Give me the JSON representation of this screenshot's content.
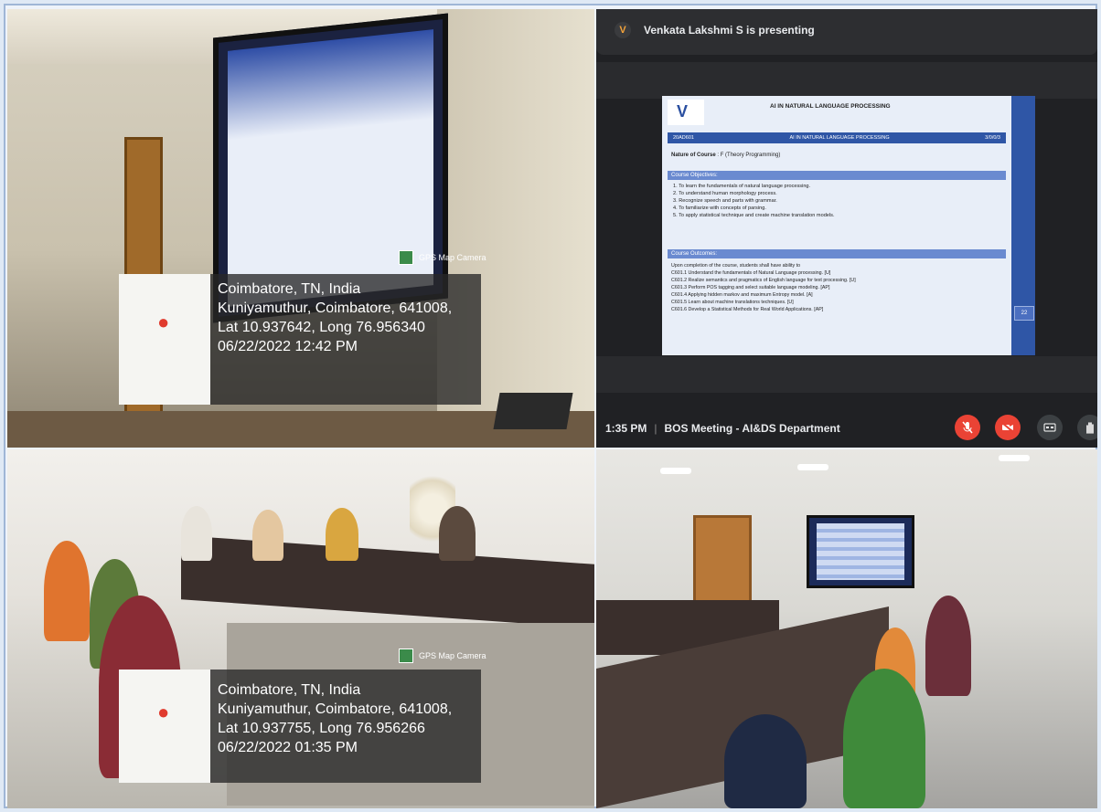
{
  "gps_top": {
    "tag": "GPS Map Camera",
    "line1": "Coimbatore, TN, India",
    "line2": "Kuniyamuthur, Coimbatore, 641008,",
    "line3": "Lat 10.937642, Long 76.956340",
    "line4": "06/22/2022 12:42 PM"
  },
  "gps_bottom": {
    "tag": "GPS Map Camera",
    "line1": "Coimbatore, TN, India",
    "line2": "Kuniyamuthur, Coimbatore, 641008,",
    "line3": "Lat 10.937755, Long 76.956266",
    "line4": "06/22/2022 01:35 PM"
  },
  "meeting": {
    "presenter_initial": "V",
    "presenter_text": "Venkata Lakshmi S is presenting",
    "time": "1:35 PM",
    "meeting_name": "BOS Meeting - AI&DS Department",
    "controls": [
      "mic-off-icon",
      "camera-off-icon",
      "captions-icon",
      "raise-hand-icon"
    ]
  },
  "slide": {
    "title": "AI IN NATURAL LANGUAGE PROCESSING",
    "code": "20AD601",
    "course": "AI IN NATURAL LANGUAGE PROCESSING",
    "credits": "3/0/0/3",
    "nature_label": "Nature of Course",
    "nature_value": ": F (Theory Programming)",
    "objectives_header": "Course Objectives:",
    "objectives": [
      "1.  To learn the fundamentals of natural language processing.",
      "2.  To understand human morphology process.",
      "3.  Recognize speech and parts with grammar.",
      "4.  To familiarize with concepts of parsing.",
      "5.  To apply statistical technique and create machine translation models."
    ],
    "outcomes_header": "Course Outcomes:",
    "outcomes_intro": "Upon completion of the course, students shall have ability to",
    "outcomes": [
      "C601.1 Understand the fundamentals of Natural Language processing. [U]",
      "C601.2 Realize semantics and pragmatics of English language for text processing. [U]",
      "C601.3 Perform POS tagging and select suitable language modeling. [AP]",
      "C601.4 Applying hidden markov and maximum Entropy model. [A]",
      "C601.5 Learn about machine translations techniques. [U]",
      "C601.6 Develop a Statistical Methods for Real World Applications. [AP]"
    ],
    "page_number": "22"
  }
}
